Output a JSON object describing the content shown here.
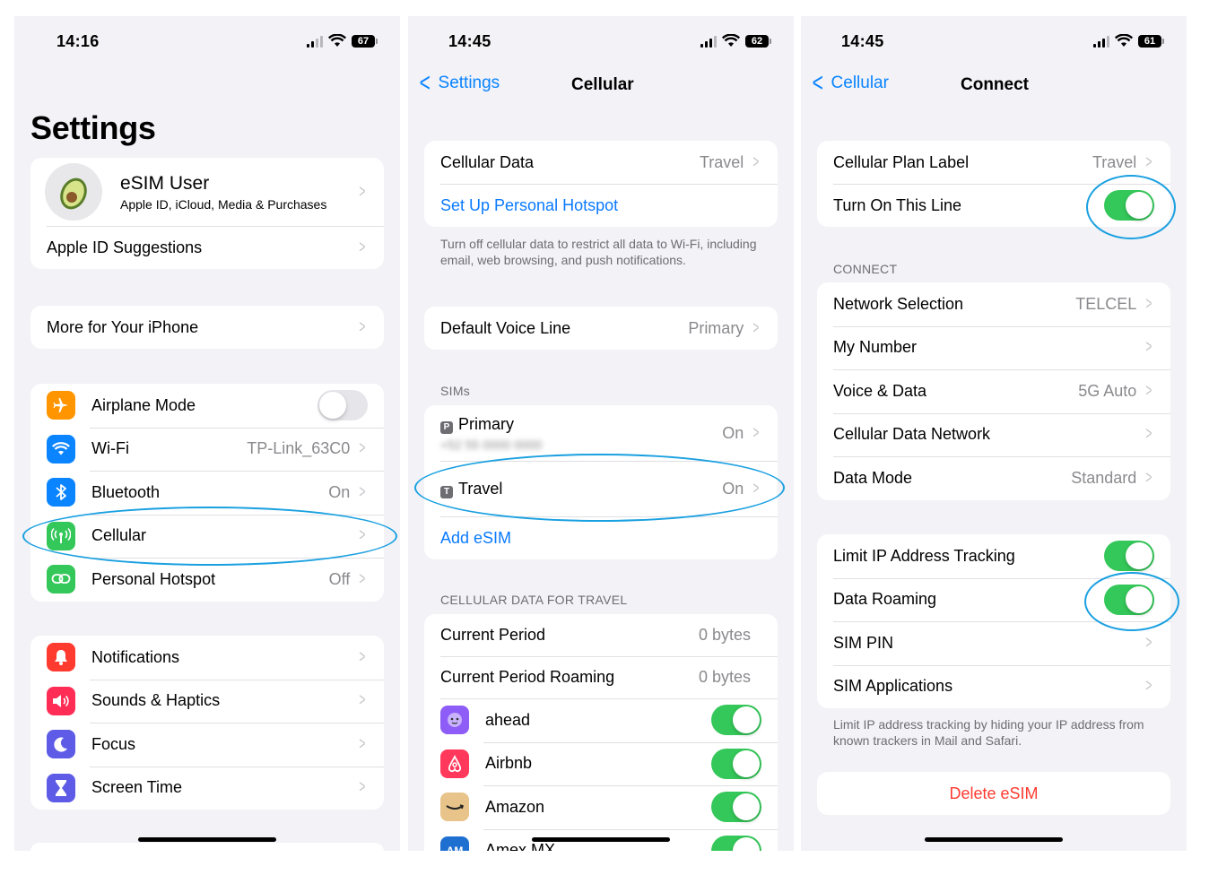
{
  "colors": {
    "accent": "#0a7aff",
    "toggle_on": "#34c759",
    "destructive": "#ff3b30",
    "highlight": "#1aa0e0"
  },
  "screen1": {
    "status_time": "14:16",
    "battery": "67",
    "title": "Settings",
    "profile": {
      "name": "eSIM User",
      "subtitle": "Apple ID, iCloud, Media & Purchases",
      "icon": "avocado-avatar"
    },
    "apple_id_suggestions": "Apple ID Suggestions",
    "more_for_iphone": "More for Your iPhone",
    "connectivity": [
      {
        "label": "Airplane Mode",
        "icon": "airplane-icon",
        "color": "#ff9500",
        "toggle": "off"
      },
      {
        "label": "Wi-Fi",
        "value": "TP-Link_63C0",
        "icon": "wifi-icon",
        "color": "#0a84ff"
      },
      {
        "label": "Bluetooth",
        "value": "On",
        "icon": "bluetooth-icon",
        "color": "#0a84ff"
      },
      {
        "label": "Cellular",
        "icon": "antenna-icon",
        "color": "#34c759"
      },
      {
        "label": "Personal Hotspot",
        "value": "Off",
        "icon": "hotspot-icon",
        "color": "#34c759"
      }
    ],
    "general": [
      {
        "label": "Notifications",
        "icon": "bell-icon",
        "color": "#ff3b30"
      },
      {
        "label": "Sounds & Haptics",
        "icon": "speaker-icon",
        "color": "#ff2d55"
      },
      {
        "label": "Focus",
        "icon": "moon-icon",
        "color": "#5e5ce6"
      },
      {
        "label": "Screen Time",
        "icon": "hourglass-icon",
        "color": "#5e5ce6"
      }
    ]
  },
  "screen2": {
    "status_time": "14:45",
    "battery": "62",
    "back": "Settings",
    "title": "Cellular",
    "cellular_data": {
      "label": "Cellular Data",
      "value": "Travel"
    },
    "hotspot": "Set Up Personal Hotspot",
    "footnote": "Turn off cellular data to restrict all data to Wi-Fi, including email, web browsing, and push notifications.",
    "default_voice": {
      "label": "Default Voice Line",
      "value": "Primary"
    },
    "sims_header": "SIMs",
    "sims": [
      {
        "badge": "P",
        "label": "Primary",
        "value": "On",
        "number": "+52 55 0000 0000"
      },
      {
        "badge": "T",
        "label": "Travel",
        "value": "On"
      }
    ],
    "add_esim": "Add eSIM",
    "data_header": "CELLULAR DATA FOR TRAVEL",
    "usage": [
      {
        "label": "Current Period",
        "value": "0 bytes"
      },
      {
        "label": "Current Period Roaming",
        "value": "0 bytes"
      }
    ],
    "apps": [
      {
        "label": "ahead",
        "color": "#8e5cf7",
        "icon": "ahead-app-icon"
      },
      {
        "label": "Airbnb",
        "color": "#ff385c",
        "icon": "airbnb-app-icon"
      },
      {
        "label": "Amazon",
        "color": "#e8c48a",
        "icon": "amazon-app-icon"
      },
      {
        "label": "Amex MX",
        "color": "#1f6fd1",
        "icon": "amex-app-icon",
        "icon_text": "AM"
      }
    ]
  },
  "screen3": {
    "status_time": "14:45",
    "battery": "61",
    "back": "Cellular",
    "title": "Connect",
    "plan_label": {
      "label": "Cellular Plan Label",
      "value": "Travel"
    },
    "turn_on": {
      "label": "Turn On This Line",
      "toggle": "on"
    },
    "connect_header": "CONNECT",
    "connect": [
      {
        "label": "Network Selection",
        "value": "TELCEL"
      },
      {
        "label": "My Number",
        "value": ""
      },
      {
        "label": "Voice & Data",
        "value": "5G Auto"
      },
      {
        "label": "Cellular Data Network",
        "value": ""
      },
      {
        "label": "Data Mode",
        "value": "Standard"
      }
    ],
    "limit_ip": {
      "label": "Limit IP Address Tracking",
      "toggle": "on"
    },
    "roaming": {
      "label": "Data Roaming",
      "toggle": "on"
    },
    "sim_pin": "SIM PIN",
    "sim_apps": "SIM Applications",
    "footnote": "Limit IP address tracking by hiding your IP address from known trackers in Mail and Safari.",
    "delete": "Delete eSIM"
  }
}
